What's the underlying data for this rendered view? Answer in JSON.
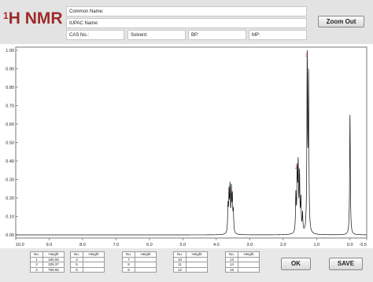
{
  "app": {
    "title": "H NMR",
    "title_sup": "1"
  },
  "info": {
    "common_name_label": "Common Name:",
    "iupac_name_label": "IUPAC Name:",
    "cas_label": "CAS No.:",
    "solvent_label": "Solvent:",
    "bp_label": "BP:",
    "mp_label": "MP:"
  },
  "toolbar": {
    "zoom_out_label": "Zoom Out",
    "ok_label": "OK",
    "save_label": "SAVE"
  },
  "tables": {
    "header_no": "No.",
    "header_height": "Height",
    "groups": [
      [
        {
          "no": "1",
          "height": "150.06"
        },
        {
          "no": "2",
          "height": "329.37"
        },
        {
          "no": "3",
          "height": "765.65"
        }
      ],
      [
        {
          "no": "4",
          "height": ""
        },
        {
          "no": "5",
          "height": ""
        },
        {
          "no": "6",
          "height": ""
        }
      ],
      [
        {
          "no": "7",
          "height": ""
        },
        {
          "no": "8",
          "height": ""
        },
        {
          "no": "9",
          "height": ""
        }
      ],
      [
        {
          "no": "10",
          "height": ""
        },
        {
          "no": "11",
          "height": ""
        },
        {
          "no": "12",
          "height": ""
        }
      ],
      [
        {
          "no": "13",
          "height": ""
        },
        {
          "no": "14",
          "height": ""
        },
        {
          "no": "15",
          "height": ""
        }
      ]
    ]
  },
  "chart_data": {
    "type": "line",
    "title": "",
    "xlabel": "",
    "ylabel": "",
    "xlim": [
      10.0,
      -0.5
    ],
    "ylim": [
      0.0,
      1.0
    ],
    "x_reversed": true,
    "grid": false,
    "x_ticks": [
      "10.0",
      "9.0",
      "8.0",
      "7.0",
      "6.0",
      "5.0",
      "4.0",
      "3.0",
      "2.0",
      "1.0",
      "0.0",
      "-0.5"
    ],
    "y_ticks": [
      "0.00",
      "0.10",
      "0.20",
      "0.30",
      "0.40",
      "0.50",
      "0.60",
      "0.70",
      "0.80",
      "0.90",
      "1.00"
    ],
    "peaks": [
      {
        "label": "1",
        "shift": 3.57,
        "height": 0.21,
        "shape": "multiplet",
        "lines": [
          3.65,
          3.62,
          3.59,
          3.55,
          3.52,
          3.49
        ],
        "intensities": [
          0.14,
          0.2,
          0.23,
          0.22,
          0.18,
          0.11
        ]
      },
      {
        "label": "2",
        "shift": 1.56,
        "height": 0.34,
        "shape": "multiplet",
        "lines": [
          1.62,
          1.58,
          1.55,
          1.51,
          1.47,
          1.42
        ],
        "intensities": [
          0.2,
          0.31,
          0.34,
          0.3,
          0.17,
          0.1
        ]
      },
      {
        "label": "3",
        "shift": 1.25,
        "height": 0.95,
        "shape": "doublet",
        "lines": [
          1.28,
          1.24
        ],
        "intensities": [
          0.95,
          0.82
        ]
      },
      {
        "label": "",
        "shift": 0.0,
        "height": 0.65,
        "shape": "singlet",
        "lines": [
          0.0
        ],
        "intensities": [
          0.65
        ]
      }
    ],
    "colors": {
      "trace": "#111111",
      "peak_label": "#cc2222"
    }
  }
}
